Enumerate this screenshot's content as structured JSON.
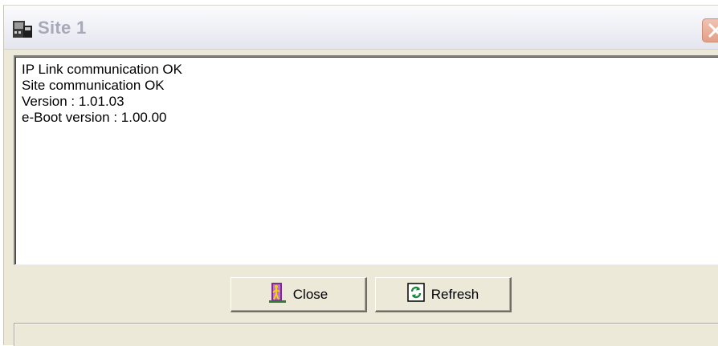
{
  "window": {
    "title": "Site 1",
    "icon": "site-app-icon",
    "close_icon": "close-icon",
    "colors": {
      "face": "#ece9d8",
      "title_text": "#a7a9b9",
      "close_button": "#e39f88"
    }
  },
  "log": {
    "lines": [
      "IP Link communication OK",
      "Site communication OK",
      "Version : 1.01.03",
      "e-Boot version : 1.00.00"
    ]
  },
  "buttons": {
    "close": {
      "label": "Close",
      "icon": "exit-door-icon"
    },
    "refresh": {
      "label": "Refresh",
      "icon": "refresh-icon"
    }
  },
  "status_bar": {
    "text": ""
  }
}
